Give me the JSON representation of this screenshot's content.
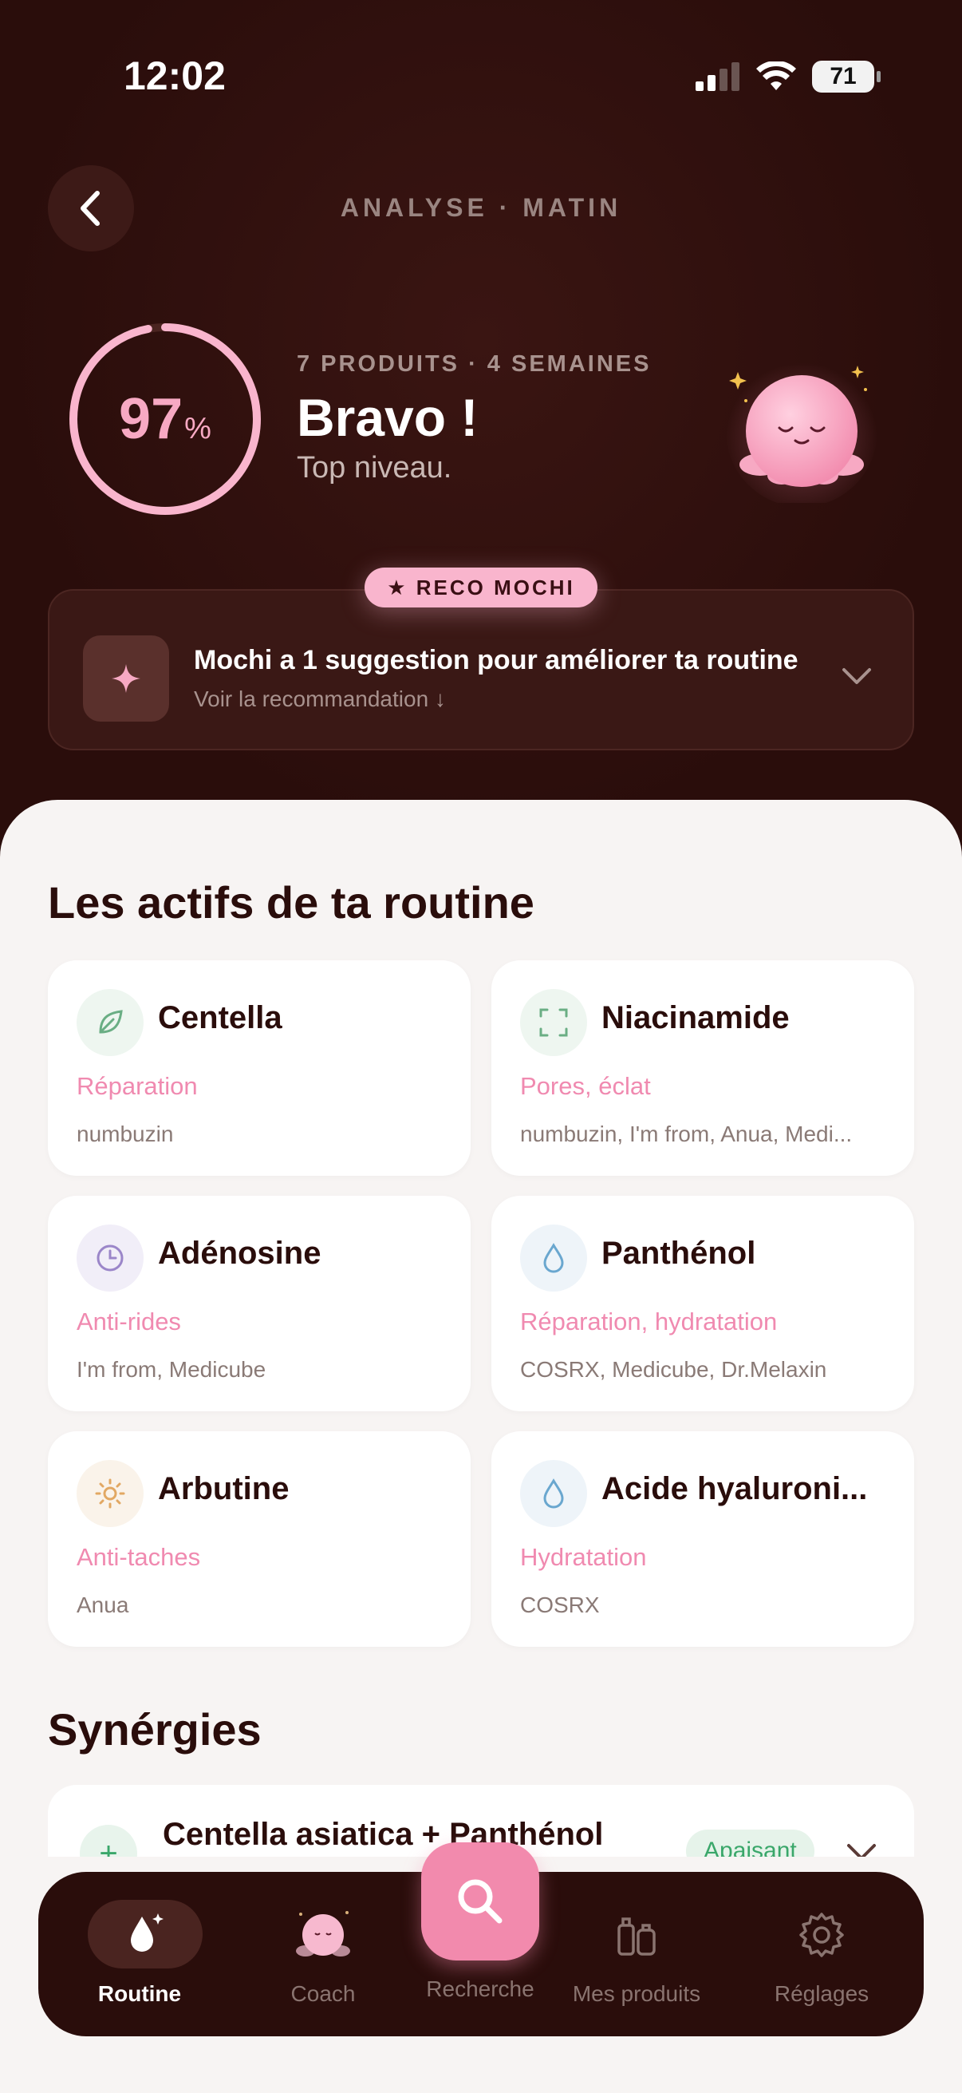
{
  "status_bar": {
    "time": "12:02",
    "battery": "71"
  },
  "header": {
    "title": "ANALYSE · MATIN"
  },
  "score": {
    "value": "97",
    "unit": "%",
    "progress": 0.97
  },
  "summary": {
    "meta": "7 PRODUITS · 4 SEMAINES",
    "headline": "Bravo !",
    "subtitle": "Top niveau."
  },
  "reco": {
    "badge": "★ RECO MOCHI",
    "title": "Mochi a 1 suggestion pour améliorer ta routine",
    "link": "Voir la recommandation ↓"
  },
  "actives": {
    "title": "Les actifs de ta routine",
    "items": [
      {
        "name": "Centella",
        "benefit": "Réparation",
        "brands": "numbuzin",
        "icon": "leaf-icon"
      },
      {
        "name": "Niacinamide",
        "benefit": "Pores, éclat",
        "brands": "numbuzin, I'm from, Anua, Medi...",
        "icon": "focus-frame-icon"
      },
      {
        "name": "Adénosine",
        "benefit": "Anti-rides",
        "brands": "I'm from, Medicube",
        "icon": "clock-icon"
      },
      {
        "name": "Panthénol",
        "benefit": "Réparation, hydratation",
        "brands": "COSRX, Medicube, Dr.Melaxin",
        "icon": "droplet-icon"
      },
      {
        "name": "Arbutine",
        "benefit": "Anti-taches",
        "brands": "Anua",
        "icon": "sun-icon"
      },
      {
        "name": "Acide hyaluroni...",
        "benefit": "Hydratation",
        "brands": "COSRX",
        "icon": "droplet-icon"
      }
    ]
  },
  "synergies": {
    "title": "Synérgies",
    "items": [
      {
        "title": "Centella asiatica + Panthénol",
        "tag": "Apaisant"
      }
    ]
  },
  "tabbar": {
    "routine": "Routine",
    "coach": "Coach",
    "search": "Recherche",
    "products": "Mes produits",
    "settings": "Réglages"
  },
  "colors": {
    "accent_pink": "#f28aad",
    "dark_bg": "#2a0d0b",
    "sheet_bg": "#f7f4f3",
    "green": "#3aa76a"
  }
}
